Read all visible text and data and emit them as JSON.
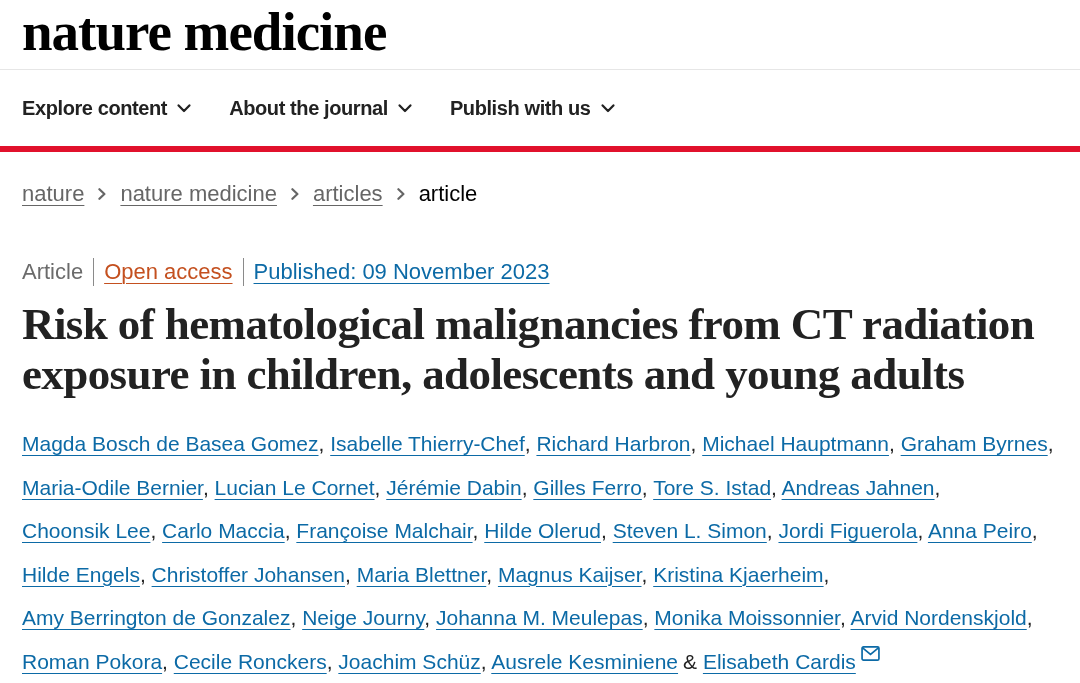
{
  "logo": {
    "text": "nature medicine"
  },
  "nav": {
    "items": [
      {
        "label": "Explore content"
      },
      {
        "label": "About the journal"
      },
      {
        "label": "Publish with us"
      }
    ]
  },
  "breadcrumb": [
    {
      "label": "nature",
      "current": false
    },
    {
      "label": "nature medicine",
      "current": false
    },
    {
      "label": "articles",
      "current": false
    },
    {
      "label": "article",
      "current": true
    }
  ],
  "article": {
    "type": "Article",
    "access": "Open access",
    "published": "Published: 09 November 2023",
    "title": "Risk of hematological malignancies from CT radiation exposure in children, adolescents and young adults",
    "authors": [
      {
        "name": "Magda Bosch de Basea Gomez",
        "contact": false,
        "joiner": {
          "kind": "comma",
          "text": ","
        }
      },
      {
        "name": "Isabelle Thierry-Chef",
        "contact": false,
        "joiner": {
          "kind": "comma",
          "text": ","
        }
      },
      {
        "name": "Richard Harbron",
        "contact": false,
        "joiner": {
          "kind": "comma",
          "text": ","
        }
      },
      {
        "name": "Michael Hauptmann",
        "contact": false,
        "joiner": {
          "kind": "comma",
          "text": ","
        }
      },
      {
        "name": "Graham Byrnes",
        "contact": false,
        "joiner": {
          "kind": "comma",
          "text": ","
        }
      },
      {
        "name": "Maria-Odile Bernier",
        "contact": false,
        "joiner": {
          "kind": "comma",
          "text": ","
        }
      },
      {
        "name": "Lucian Le Cornet",
        "contact": false,
        "joiner": {
          "kind": "comma",
          "text": ","
        }
      },
      {
        "name": "Jérémie Dabin",
        "contact": false,
        "joiner": {
          "kind": "comma",
          "text": ","
        }
      },
      {
        "name": "Gilles Ferro",
        "contact": false,
        "joiner": {
          "kind": "comma",
          "text": ","
        }
      },
      {
        "name": "Tore S. Istad",
        "contact": false,
        "joiner": {
          "kind": "comma",
          "text": ","
        }
      },
      {
        "name": "Andreas Jahnen",
        "contact": false,
        "joiner": {
          "kind": "comma",
          "text": ","
        }
      },
      {
        "name": "Choonsik Lee",
        "contact": false,
        "joiner": {
          "kind": "comma",
          "text": ","
        }
      },
      {
        "name": "Carlo Maccia",
        "contact": false,
        "joiner": {
          "kind": "comma",
          "text": ","
        }
      },
      {
        "name": "Françoise Malchair",
        "contact": false,
        "joiner": {
          "kind": "comma",
          "text": ","
        }
      },
      {
        "name": "Hilde Olerud",
        "contact": false,
        "joiner": {
          "kind": "comma",
          "text": ","
        }
      },
      {
        "name": "Steven L. Simon",
        "contact": false,
        "joiner": {
          "kind": "comma",
          "text": ","
        }
      },
      {
        "name": "Jordi Figuerola",
        "contact": false,
        "joiner": {
          "kind": "comma",
          "text": ","
        }
      },
      {
        "name": "Anna Peiro",
        "contact": false,
        "joiner": {
          "kind": "comma",
          "text": ","
        }
      },
      {
        "name": "Hilde Engels",
        "contact": false,
        "joiner": {
          "kind": "comma",
          "text": ","
        }
      },
      {
        "name": "Christoffer Johansen",
        "contact": false,
        "joiner": {
          "kind": "comma",
          "text": ","
        }
      },
      {
        "name": "Maria Blettner",
        "contact": false,
        "joiner": {
          "kind": "comma",
          "text": ","
        }
      },
      {
        "name": "Magnus Kaijser",
        "contact": false,
        "joiner": {
          "kind": "comma",
          "text": ","
        }
      },
      {
        "name": "Kristina Kjaerheim",
        "contact": false,
        "joiner": {
          "kind": "comma",
          "text": ","
        }
      },
      {
        "name": "Amy Berrington de Gonzalez",
        "contact": false,
        "joiner": {
          "kind": "comma",
          "text": ","
        }
      },
      {
        "name": "Neige Journy",
        "contact": false,
        "joiner": {
          "kind": "comma",
          "text": ","
        }
      },
      {
        "name": "Johanna M. Meulepas",
        "contact": false,
        "joiner": {
          "kind": "comma",
          "text": ","
        }
      },
      {
        "name": "Monika Moissonnier",
        "contact": false,
        "joiner": {
          "kind": "comma",
          "text": ","
        }
      },
      {
        "name": "Arvid Nordenskjold",
        "contact": false,
        "joiner": {
          "kind": "comma",
          "text": ","
        }
      },
      {
        "name": "Roman Pokora",
        "contact": false,
        "joiner": {
          "kind": "comma",
          "text": ","
        }
      },
      {
        "name": "Cecile Ronckers",
        "contact": false,
        "joiner": {
          "kind": "comma",
          "text": ","
        }
      },
      {
        "name": "Joachim Schüz",
        "contact": false,
        "joiner": {
          "kind": "comma",
          "text": ","
        }
      },
      {
        "name": "Ausrele Kesminiene",
        "contact": false,
        "joiner": {
          "kind": "conjunction",
          "text": "&"
        }
      },
      {
        "name": "Elisabeth Cardis",
        "contact": true
      }
    ]
  }
}
